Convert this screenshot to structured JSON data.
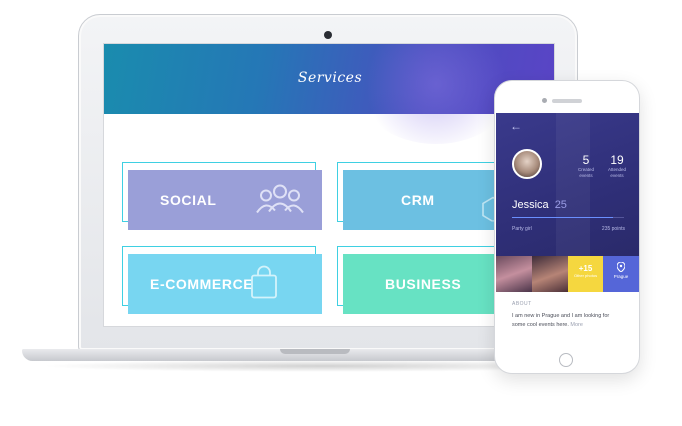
{
  "laptop": {
    "header_title": "Services",
    "tiles": [
      {
        "label": "SOCIAL",
        "icon": "group-icon",
        "color": "#9a9fd8"
      },
      {
        "label": "CRM",
        "icon": "hexagons-icon",
        "color": "#6cc0e2"
      },
      {
        "label": "E-COMMERCE",
        "icon": "shopping-bag-icon",
        "color": "#78d6f1"
      },
      {
        "label": "BUSINESS",
        "icon": "bar-chart-icon",
        "color": "#67e2c3"
      }
    ]
  },
  "phone": {
    "back_icon": "back-arrow-icon",
    "stats": [
      {
        "value": "5",
        "label": "Created events"
      },
      {
        "value": "19",
        "label": "Attended events"
      }
    ],
    "name": "Jessica",
    "age": "25",
    "progress_fraction": 0.9,
    "tagline": "Party girl",
    "points": "235 points",
    "photos": {
      "more_count": "+15",
      "more_label": "Other photos",
      "location_label": "Prague",
      "location_icon": "map-pin-icon"
    },
    "about_title": "ABOUT",
    "about_text": "I am new in Prague and I am looking for some cool events here.",
    "about_more": "More"
  },
  "colors": {
    "header_gradient_start": "#1a8cae",
    "header_gradient_end": "#5a44c6",
    "profile_bg": "#2f2f78",
    "accent_yellow": "#f5d73f",
    "accent_blue": "#5566d8"
  }
}
